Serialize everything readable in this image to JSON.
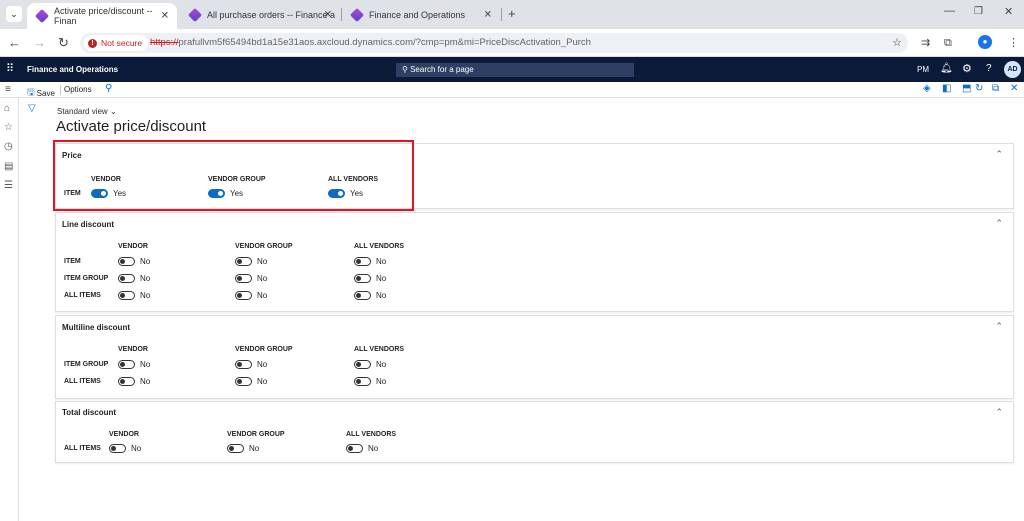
{
  "browser": {
    "tabs": [
      {
        "title": "Activate price/discount -- Finan"
      },
      {
        "title": "All purchase orders -- Finance a"
      },
      {
        "title": "Finance and Operations"
      }
    ],
    "not_secure": "Not secure",
    "url_scheme": "https://",
    "url_rest": "prafullvm5f65494bd1a15e31aos.axcloud.dynamics.com/?cmp=pm&mi=PriceDiscActivation_Purch"
  },
  "appbar": {
    "app_name": "Finance and Operations",
    "search_placeholder": "Search for a page",
    "company": "PM",
    "avatar": "AD"
  },
  "actionpane": {
    "save": "Save",
    "options": "Options"
  },
  "page": {
    "view": "Standard view",
    "title": "Activate price/discount"
  },
  "sections": [
    {
      "title": "Price",
      "columns": [
        "VENDOR",
        "VENDOR GROUP",
        "ALL VENDORS"
      ],
      "rows": [
        {
          "label": "ITEM",
          "values": [
            "Yes",
            "Yes",
            "Yes"
          ],
          "on": [
            true,
            true,
            true
          ]
        }
      ]
    },
    {
      "title": "Line discount",
      "columns": [
        "VENDOR",
        "VENDOR GROUP",
        "ALL VENDORS"
      ],
      "rows": [
        {
          "label": "ITEM",
          "values": [
            "No",
            "No",
            "No"
          ],
          "on": [
            false,
            false,
            false
          ]
        },
        {
          "label": "ITEM GROUP",
          "values": [
            "No",
            "No",
            "No"
          ],
          "on": [
            false,
            false,
            false
          ]
        },
        {
          "label": "ALL ITEMS",
          "values": [
            "No",
            "No",
            "No"
          ],
          "on": [
            false,
            false,
            false
          ]
        }
      ]
    },
    {
      "title": "Multiline discount",
      "columns": [
        "VENDOR",
        "VENDOR GROUP",
        "ALL VENDORS"
      ],
      "rows": [
        {
          "label": "ITEM GROUP",
          "values": [
            "No",
            "No",
            "No"
          ],
          "on": [
            false,
            false,
            false
          ]
        },
        {
          "label": "ALL ITEMS",
          "values": [
            "No",
            "No",
            "No"
          ],
          "on": [
            false,
            false,
            false
          ]
        }
      ]
    },
    {
      "title": "Total discount",
      "columns": [
        "VENDOR",
        "VENDOR GROUP",
        "ALL VENDORS"
      ],
      "rows": [
        {
          "label": "ALL ITEMS",
          "values": [
            "No",
            "No",
            "No"
          ],
          "on": [
            false,
            false,
            false
          ]
        }
      ]
    }
  ],
  "colors": {
    "accent": "#0f6cbd",
    "highlight": "#e81123",
    "appbar": "#0b1a38"
  }
}
